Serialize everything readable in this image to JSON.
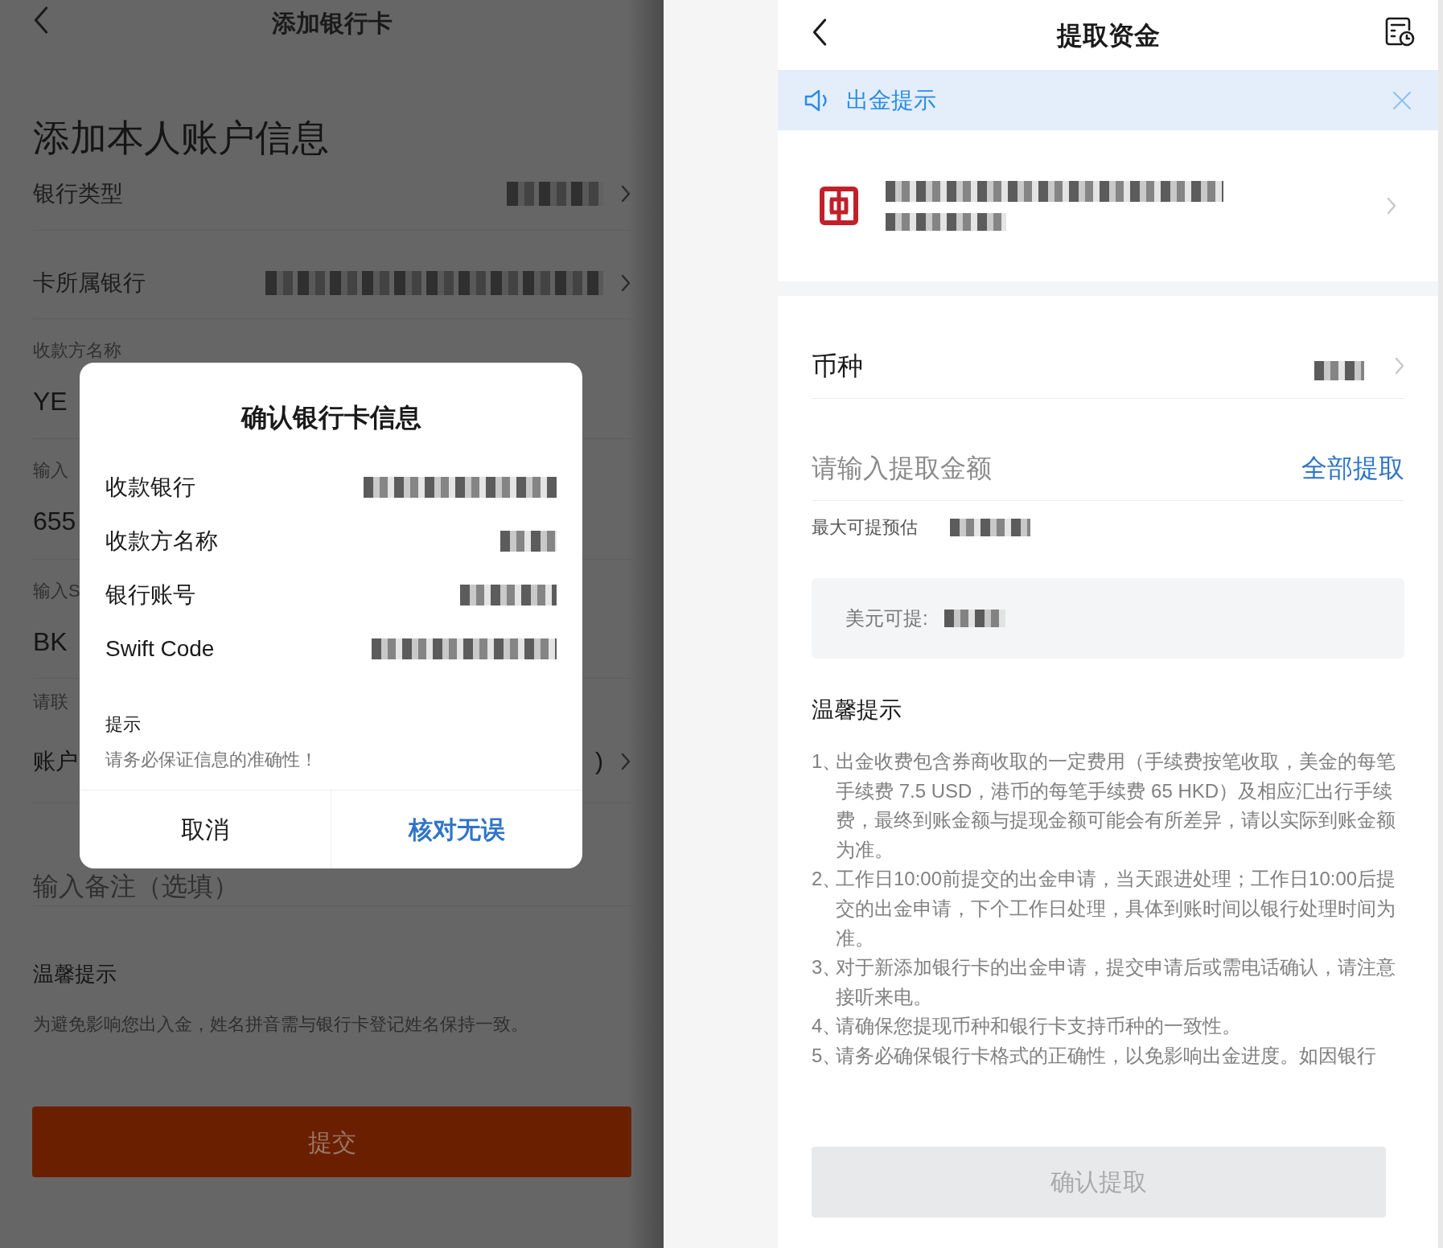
{
  "left_screen": {
    "header": {
      "title": "添加银行卡"
    },
    "heading": "添加本人账户信息",
    "rows": [
      {
        "kind": "select",
        "label": "银行类型"
      },
      {
        "kind": "select",
        "label": "卡所属银行"
      },
      {
        "kind": "field",
        "label": "收款方名称",
        "value": "YE"
      },
      {
        "kind": "field",
        "label": "输入",
        "value": "655"
      },
      {
        "kind": "field",
        "label": "输入S",
        "value": "BK"
      },
      {
        "kind": "picker",
        "label": "请联",
        "value": "账户",
        "trailing": ")"
      },
      {
        "kind": "input",
        "placeholder": "输入备注（选填）"
      }
    ],
    "tips": {
      "title": "温馨提示",
      "text": "为避免影响您出入金，姓名拼音需与银行卡登记姓名保持一致。"
    },
    "submit_button": {
      "label": "提交"
    }
  },
  "dialog": {
    "title": "确认银行卡信息",
    "rows": [
      {
        "label": "收款银行"
      },
      {
        "label": "收款方名称"
      },
      {
        "label": "银行账号"
      },
      {
        "label": "Swift Code"
      }
    ],
    "notice_title": "提示",
    "notice_text": "请务必保证信息的准确性！",
    "buttons": [
      {
        "kind": "cancel",
        "label": "取消"
      },
      {
        "kind": "confirm",
        "label": "核对无误"
      }
    ]
  },
  "right_screen": {
    "header": {
      "title": "提取资金"
    },
    "banner": {
      "text": "出金提示"
    },
    "currency": {
      "label": "币种"
    },
    "amount": {
      "placeholder": "请输入提取金额",
      "action": "全部提取"
    },
    "max_estimate": {
      "label": "最大可提预估"
    },
    "available": {
      "label": "美元可提:"
    },
    "tips": {
      "title": "温馨提示",
      "items": [
        {
          "number": "1、",
          "text": "出金收费包含券商收取的一定费用（手续费按笔收取，美金的每笔手续费 7.5 USD，港币的每笔手续费 65 HKD）及相应汇出行手续费，最终到账金额与提现金额可能会有所差异，请以实际到账金额为准。"
        },
        {
          "number": "2、",
          "text": "工作日10:00前提交的出金申请，当天跟进处理；工作日10:00后提交的出金申请，下个工作日处理，具体到账时间以银行处理时间为准。"
        },
        {
          "number": "3、",
          "text": "对于新添加银行卡的出金申请，提交申请后或需电话确认，请注意接听来电。"
        },
        {
          "number": "4、",
          "text": "请确保您提现币种和银行卡支持币种的一致性。"
        },
        {
          "number": "5、",
          "text": "请务必确保银行卡格式的正确性，以免影响出金进度。如因银行"
        }
      ]
    },
    "confirm_button": {
      "label": "确认提取",
      "disabled": true
    }
  }
}
